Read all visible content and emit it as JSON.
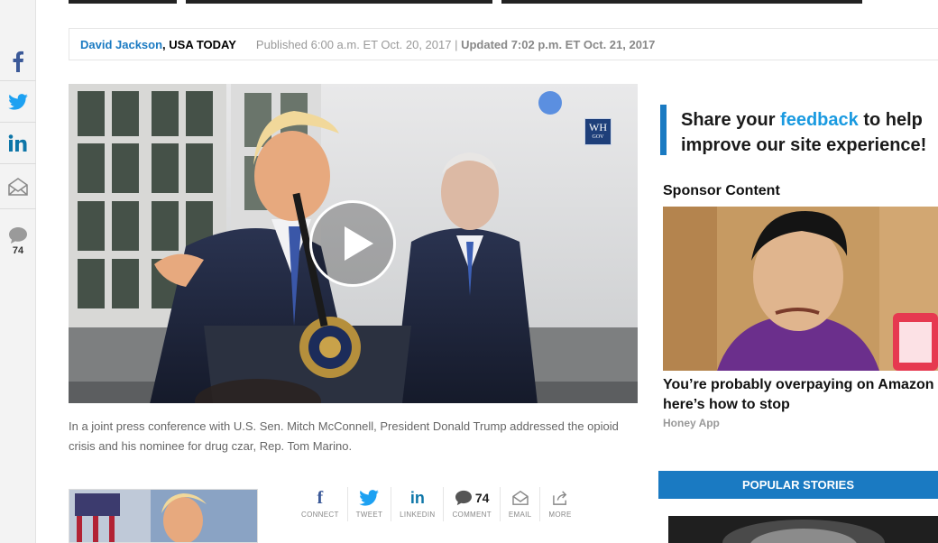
{
  "rail": {
    "facebook_icon": "facebook-icon",
    "twitter_icon": "twitter-icon",
    "linkedin_icon": "linkedin-icon",
    "email_icon": "email-icon",
    "comment_icon": "comment-icon",
    "comment_count": "74"
  },
  "article": {
    "author": "David Jackson",
    "organization": ", USA TODAY",
    "published": "Published 6:00 a.m. ET Oct. 20, 2017 | ",
    "updated": "Updated 7:02 p.m. ET Oct. 21, 2017",
    "caption": "In a joint press conference with U.S. Sen. Mitch McConnell, President Donald Trump addressed the opioid crisis and his nominee for drug czar, Rep. Tom Marino."
  },
  "video": {
    "badge_main": "WH",
    "badge_sub": "GOV"
  },
  "share": [
    {
      "label": "CONNECT",
      "icon": "facebook-icon"
    },
    {
      "label": "TWEET",
      "icon": "twitter-icon"
    },
    {
      "label": "LINKEDIN",
      "icon": "linkedin-icon"
    },
    {
      "label": "COMMENT",
      "icon": "comment-icon",
      "count": "74"
    },
    {
      "label": "EMAIL",
      "icon": "email-icon"
    },
    {
      "label": "MORE",
      "icon": "share-icon"
    }
  ],
  "sidebar": {
    "feedback_pre": "Share your ",
    "feedback_link": "feedback",
    "feedback_post": " to help",
    "feedback_line2": "improve our site experience!",
    "sponsor_title": "Sponsor Content",
    "sponsor_headline_1": "You’re probably overpaying on Amazon",
    "sponsor_headline_2": "here’s how to stop",
    "sponsor_source": "Honey App",
    "popular_label": "POPULAR STORIES"
  },
  "colors": {
    "accent": "#1a7ac2",
    "facebook": "#3b5998",
    "twitter": "#1da1f2",
    "linkedin": "#0e76a8"
  }
}
